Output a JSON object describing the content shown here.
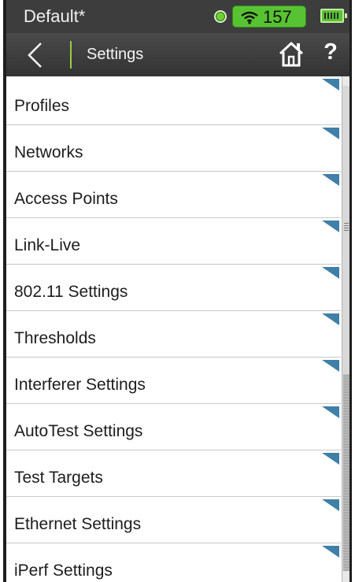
{
  "status_bar": {
    "profile_name": "Default*",
    "wifi_count": "157",
    "icons": [
      "status-indicator-icon",
      "wifi-icon",
      "battery-icon"
    ]
  },
  "nav": {
    "title": "Settings",
    "icons": [
      "back-icon",
      "home-icon",
      "help-icon"
    ],
    "help_label": "?"
  },
  "settings": {
    "items": [
      {
        "label": "Profiles"
      },
      {
        "label": "Networks"
      },
      {
        "label": "Access Points"
      },
      {
        "label": "Link-Live"
      },
      {
        "label": "802.11 Settings"
      },
      {
        "label": "Thresholds"
      },
      {
        "label": "Interferer Settings"
      },
      {
        "label": "AutoTest Settings"
      },
      {
        "label": "Test Targets"
      },
      {
        "label": "Ethernet Settings"
      },
      {
        "label": "iPerf Settings"
      }
    ]
  },
  "colors": {
    "status_bar_bg": "#3d3d3d",
    "accent_green": "#58c332",
    "nav_divider": "#9ccb3e",
    "corner_marker": "#3f7fa8"
  }
}
